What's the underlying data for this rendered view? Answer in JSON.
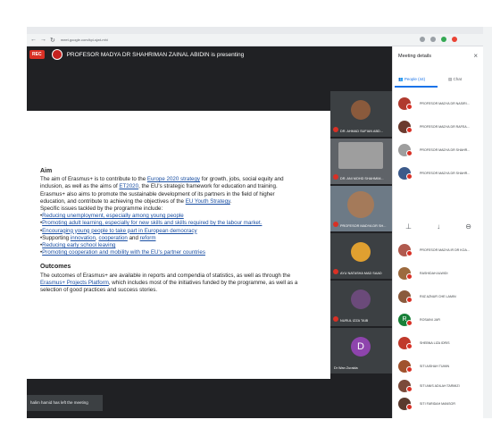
{
  "browser": {
    "url": "meet.google.com/kpi-sjwt-mhi"
  },
  "meet": {
    "rec_label": "REC",
    "presenter_text": "PROFESOR MADYA DR SHAHRIMAN ZAINAL ABIDIN is presenting",
    "toast": "halim hamid has left the meeting"
  },
  "slide": {
    "aim_heading": "Aim",
    "aim_p1_a": "The aim of Erasmus+ is to contribute to the ",
    "aim_p1_link1": "Europe 2020 strategy",
    "aim_p1_b": " for growth, jobs, social equity and inclusion, as well as the aims of ",
    "aim_p1_link2": "ET2020",
    "aim_p1_c": ", the EU's strategic framework for education and training.",
    "aim_p2_a": "Erasmus+ also aims to promote the sustainable development of its partners in the field of higher education, and contribute to achieving the objectives of the ",
    "aim_p2_link": "EU Youth Strategy",
    "aim_p2_b": ".",
    "issues_intro": "Specific issues tackled by the programme include:",
    "issue1": "Reducing unemployment, especially among young people",
    "issue2": "Promoting adult learning, especially for new skills and skills required by the labour market.",
    "issue3": "Encouraging young people to take part in European democracy",
    "issue4_a": "Supporting ",
    "issue4_link1": "innovation",
    "issue4_sep1": ", ",
    "issue4_link2": "cooperation",
    "issue4_sep2": " and ",
    "issue4_link3": "reform",
    "issue5": "Reducing early school leaving",
    "issue6": "Promoting cooperation and mobility with the EU's partner countries",
    "outcomes_heading": "Outcomes",
    "out_a": "The outcomes of Erasmus+ are available in reports and compendia of statistics, as well as through the ",
    "out_link": "Erasmus+ Projects Platform",
    "out_b": ", which includes most of the initiatives funded by the programme, as well as a selection of good practices and success stories."
  },
  "tiles": [
    {
      "name": "DR. AHMAD SUFIAN ABD..."
    },
    {
      "name": "DR. ANI MOHD SHAHMIM..."
    },
    {
      "name": "PROFESOR MADYA DR SH..."
    },
    {
      "name": "AYU NATASHA MAD SAAD"
    },
    {
      "name": "NURUL IZZA TAIB"
    },
    {
      "name": "Dr Wan Zuraida",
      "initial": "D"
    }
  ],
  "panel": {
    "title": "Meeting details",
    "close": "×",
    "tab_people": "People (44)",
    "tab_chat": "Chat",
    "participants": [
      "PROFESOR MADYA DR NASIRI...",
      "PROFESOR MADYA DR RAFEA...",
      "PROFESOR MADYA DR SHAHR...",
      "PROFESOR MADYA DR SHAHR...",
      "PROFESOR MADYA IR DR KOA...",
      "RASHIDAH ALWIDI",
      "RIIZ AZNUR CHE LAMIN",
      "ROSAINI JAFI",
      "SHEBNA LIZA IDRIS",
      "SITI AISHAH TUMIN",
      "SITI ANIS ADILAH TARMIZI",
      "SITI FARIDAH MANSOR",
      "SITI FARIHAH"
    ]
  },
  "colors": {
    "meet_bg": "#202124",
    "accent": "#1a73e8",
    "mic_off": "#d93025",
    "link": "#1a4fa3"
  }
}
